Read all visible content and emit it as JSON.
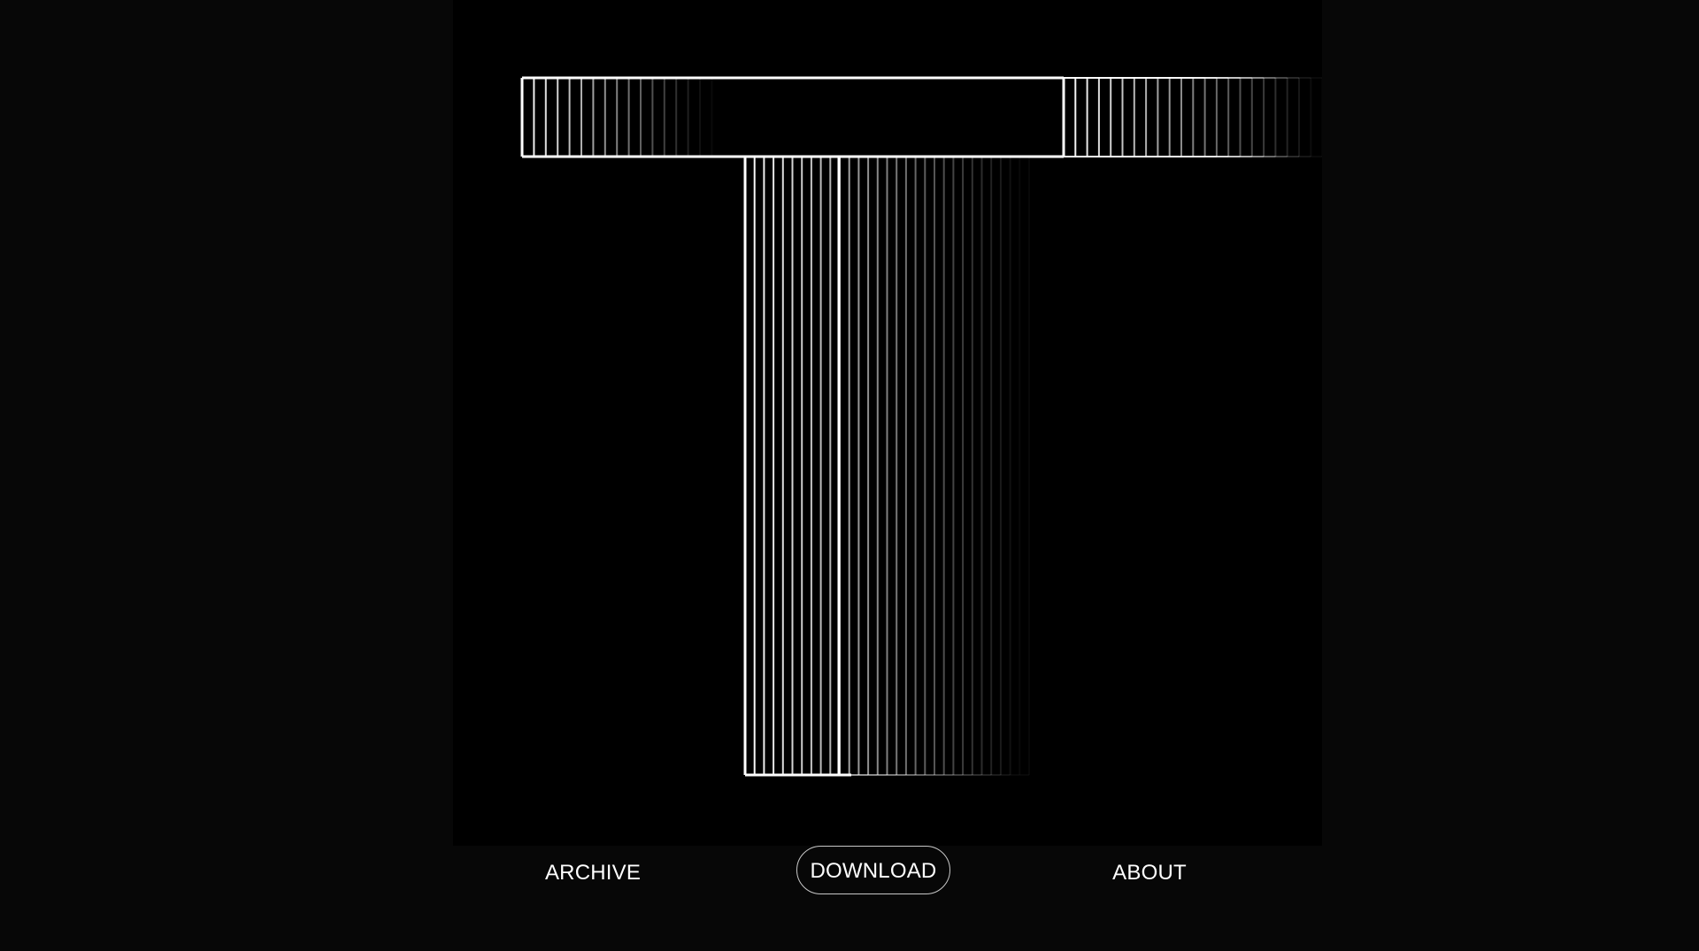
{
  "artwork": {
    "glyph": "T",
    "icon": "outlined-letter-t-icon",
    "line_color": "#ffffff",
    "background": "#000000"
  },
  "nav": {
    "archive_label": "ARCHIVE",
    "download_label": "DOWNLOAD",
    "about_label": "ABOUT"
  },
  "colors": {
    "page_background": "#070707",
    "stage_background": "#000000",
    "text": "#ffffff",
    "pill_border": "#c8c8c8"
  }
}
